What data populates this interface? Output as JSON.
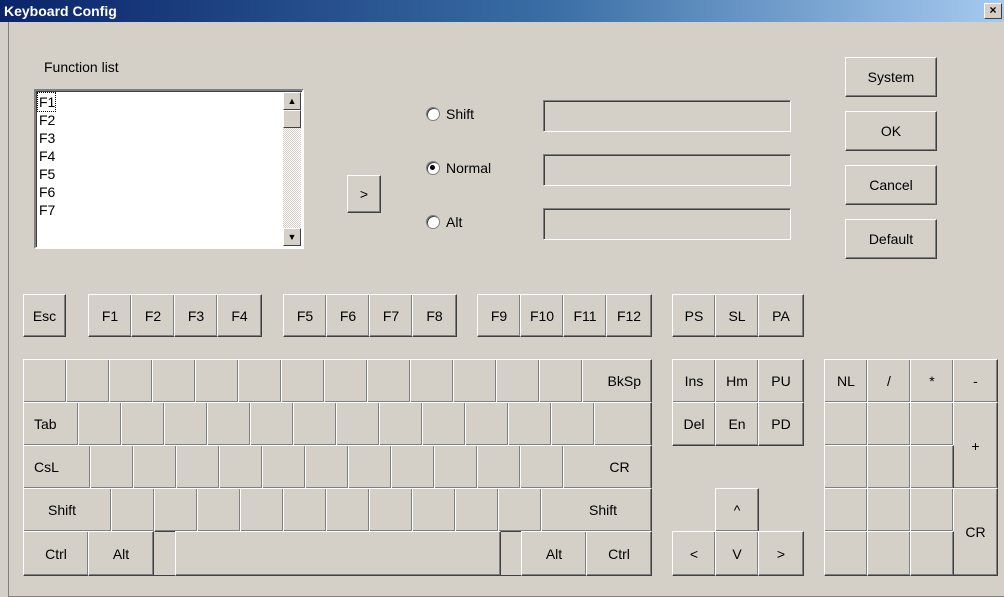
{
  "window": {
    "title": "Keyboard Config",
    "close_glyph": "×"
  },
  "function_list": {
    "label": "Function list",
    "items": [
      "F1",
      "F2",
      "F3",
      "F4",
      "F5",
      "F6",
      "F7"
    ],
    "scroll_up_icon": "▲",
    "scroll_down_icon": "▼"
  },
  "assign_button": ">",
  "modifiers": {
    "shift": {
      "label": "Shift",
      "value": ""
    },
    "normal": {
      "label": "Normal",
      "value": "",
      "selected": true
    },
    "alt": {
      "label": "Alt",
      "value": ""
    }
  },
  "buttons": {
    "system": "System",
    "ok": "OK",
    "cancel": "Cancel",
    "default": "Default"
  },
  "function_row": {
    "esc": "Esc",
    "f": [
      "F1",
      "F2",
      "F3",
      "F4",
      "F5",
      "F6",
      "F7",
      "F8",
      "F9",
      "F10",
      "F11",
      "F12"
    ],
    "ps": "PS",
    "sl": "SL",
    "pa": "PA"
  },
  "main_keys": {
    "bksp": "BkSp",
    "tab": "Tab",
    "csl": "CsL",
    "cr": "CR",
    "shift_left": "Shift",
    "shift_right": "Shift",
    "ctrl_left": "Ctrl",
    "alt_left": "Alt",
    "alt_right": "Alt",
    "ctrl_right": "Ctrl"
  },
  "nav_keys": {
    "ins": "Ins",
    "hm": "Hm",
    "pu": "PU",
    "del": "Del",
    "en": "En",
    "pd": "PD"
  },
  "arrow_keys": {
    "up": "^",
    "left": "<",
    "down": "V",
    "right": ">"
  },
  "numpad": {
    "nl": "NL",
    "slash": "/",
    "star": "*",
    "minus": "-",
    "plus": "+",
    "cr": "CR"
  }
}
